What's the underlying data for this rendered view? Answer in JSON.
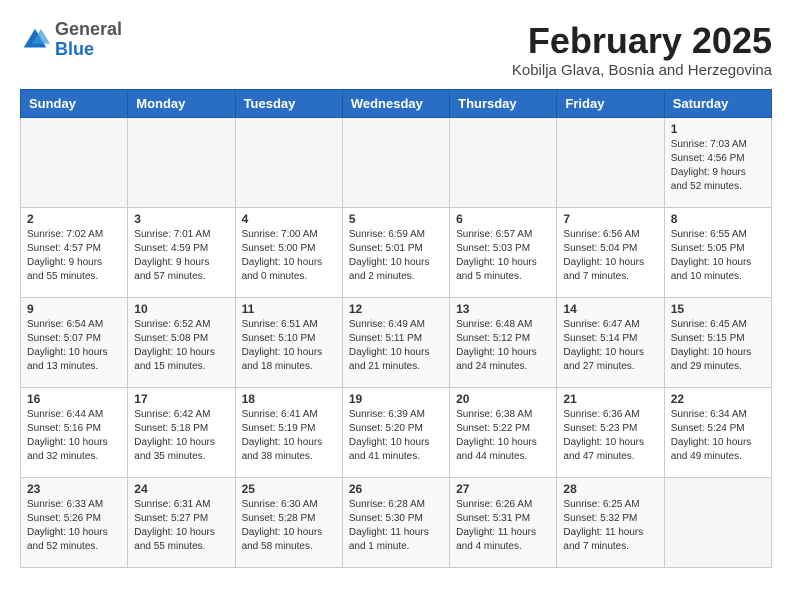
{
  "header": {
    "logo": {
      "general": "General",
      "blue": "Blue"
    },
    "title": "February 2025",
    "subtitle": "Kobilja Glava, Bosnia and Herzegovina"
  },
  "weekdays": [
    "Sunday",
    "Monday",
    "Tuesday",
    "Wednesday",
    "Thursday",
    "Friday",
    "Saturday"
  ],
  "weeks": [
    [
      {
        "day": "",
        "info": ""
      },
      {
        "day": "",
        "info": ""
      },
      {
        "day": "",
        "info": ""
      },
      {
        "day": "",
        "info": ""
      },
      {
        "day": "",
        "info": ""
      },
      {
        "day": "",
        "info": ""
      },
      {
        "day": "1",
        "info": "Sunrise: 7:03 AM\nSunset: 4:56 PM\nDaylight: 9 hours and 52 minutes."
      }
    ],
    [
      {
        "day": "2",
        "info": "Sunrise: 7:02 AM\nSunset: 4:57 PM\nDaylight: 9 hours and 55 minutes."
      },
      {
        "day": "3",
        "info": "Sunrise: 7:01 AM\nSunset: 4:59 PM\nDaylight: 9 hours and 57 minutes."
      },
      {
        "day": "4",
        "info": "Sunrise: 7:00 AM\nSunset: 5:00 PM\nDaylight: 10 hours and 0 minutes."
      },
      {
        "day": "5",
        "info": "Sunrise: 6:59 AM\nSunset: 5:01 PM\nDaylight: 10 hours and 2 minutes."
      },
      {
        "day": "6",
        "info": "Sunrise: 6:57 AM\nSunset: 5:03 PM\nDaylight: 10 hours and 5 minutes."
      },
      {
        "day": "7",
        "info": "Sunrise: 6:56 AM\nSunset: 5:04 PM\nDaylight: 10 hours and 7 minutes."
      },
      {
        "day": "8",
        "info": "Sunrise: 6:55 AM\nSunset: 5:05 PM\nDaylight: 10 hours and 10 minutes."
      }
    ],
    [
      {
        "day": "9",
        "info": "Sunrise: 6:54 AM\nSunset: 5:07 PM\nDaylight: 10 hours and 13 minutes."
      },
      {
        "day": "10",
        "info": "Sunrise: 6:52 AM\nSunset: 5:08 PM\nDaylight: 10 hours and 15 minutes."
      },
      {
        "day": "11",
        "info": "Sunrise: 6:51 AM\nSunset: 5:10 PM\nDaylight: 10 hours and 18 minutes."
      },
      {
        "day": "12",
        "info": "Sunrise: 6:49 AM\nSunset: 5:11 PM\nDaylight: 10 hours and 21 minutes."
      },
      {
        "day": "13",
        "info": "Sunrise: 6:48 AM\nSunset: 5:12 PM\nDaylight: 10 hours and 24 minutes."
      },
      {
        "day": "14",
        "info": "Sunrise: 6:47 AM\nSunset: 5:14 PM\nDaylight: 10 hours and 27 minutes."
      },
      {
        "day": "15",
        "info": "Sunrise: 6:45 AM\nSunset: 5:15 PM\nDaylight: 10 hours and 29 minutes."
      }
    ],
    [
      {
        "day": "16",
        "info": "Sunrise: 6:44 AM\nSunset: 5:16 PM\nDaylight: 10 hours and 32 minutes."
      },
      {
        "day": "17",
        "info": "Sunrise: 6:42 AM\nSunset: 5:18 PM\nDaylight: 10 hours and 35 minutes."
      },
      {
        "day": "18",
        "info": "Sunrise: 6:41 AM\nSunset: 5:19 PM\nDaylight: 10 hours and 38 minutes."
      },
      {
        "day": "19",
        "info": "Sunrise: 6:39 AM\nSunset: 5:20 PM\nDaylight: 10 hours and 41 minutes."
      },
      {
        "day": "20",
        "info": "Sunrise: 6:38 AM\nSunset: 5:22 PM\nDaylight: 10 hours and 44 minutes."
      },
      {
        "day": "21",
        "info": "Sunrise: 6:36 AM\nSunset: 5:23 PM\nDaylight: 10 hours and 47 minutes."
      },
      {
        "day": "22",
        "info": "Sunrise: 6:34 AM\nSunset: 5:24 PM\nDaylight: 10 hours and 49 minutes."
      }
    ],
    [
      {
        "day": "23",
        "info": "Sunrise: 6:33 AM\nSunset: 5:26 PM\nDaylight: 10 hours and 52 minutes."
      },
      {
        "day": "24",
        "info": "Sunrise: 6:31 AM\nSunset: 5:27 PM\nDaylight: 10 hours and 55 minutes."
      },
      {
        "day": "25",
        "info": "Sunrise: 6:30 AM\nSunset: 5:28 PM\nDaylight: 10 hours and 58 minutes."
      },
      {
        "day": "26",
        "info": "Sunrise: 6:28 AM\nSunset: 5:30 PM\nDaylight: 11 hours and 1 minute."
      },
      {
        "day": "27",
        "info": "Sunrise: 6:26 AM\nSunset: 5:31 PM\nDaylight: 11 hours and 4 minutes."
      },
      {
        "day": "28",
        "info": "Sunrise: 6:25 AM\nSunset: 5:32 PM\nDaylight: 11 hours and 7 minutes."
      },
      {
        "day": "",
        "info": ""
      }
    ]
  ]
}
